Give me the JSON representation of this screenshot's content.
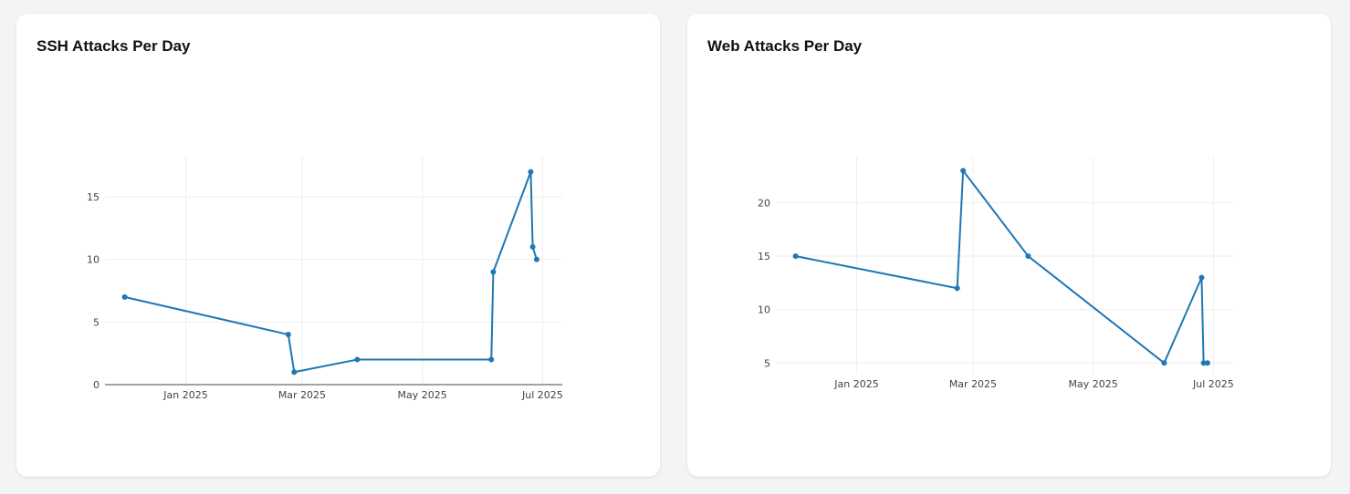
{
  "cards": [
    {
      "title": "SSH Attacks Per Day"
    },
    {
      "title": "Web Attacks Per Day"
    }
  ],
  "colors": {
    "line": "#1f77b4",
    "grid": "#eeeeee",
    "axis": "#444444",
    "card_background": "#ffffff",
    "page_background": "#f3f4f6"
  },
  "chart_data": [
    {
      "type": "line",
      "title": "SSH Attacks Per Day",
      "xlabel": "",
      "ylabel": "",
      "grid": true,
      "xlim": [
        "2024-11-21",
        "2025-07-11"
      ],
      "ylim": [
        0,
        18.2
      ],
      "x_ticks": [
        {
          "date": "2025-01-01",
          "label": "Jan 2025"
        },
        {
          "date": "2025-03-01",
          "label": "Mar 2025"
        },
        {
          "date": "2025-05-01",
          "label": "May 2025"
        },
        {
          "date": "2025-07-01",
          "label": "Jul 2025"
        }
      ],
      "y_ticks": [
        0,
        5,
        10,
        15
      ],
      "series": [
        {
          "x": [
            "2024-12-01",
            "2025-02-22",
            "2025-02-25",
            "2025-03-29",
            "2025-06-05",
            "2025-06-06",
            "2025-06-25",
            "2025-06-26",
            "2025-06-28"
          ],
          "y": [
            7,
            4,
            1,
            2,
            2,
            9,
            17,
            11,
            10
          ]
        }
      ]
    },
    {
      "type": "line",
      "title": "Web Attacks Per Day",
      "xlabel": "",
      "ylabel": "",
      "grid": true,
      "xlim": [
        "2024-11-21",
        "2025-07-11"
      ],
      "ylim": [
        4.0,
        24.3
      ],
      "x_ticks": [
        {
          "date": "2025-01-01",
          "label": "Jan 2025"
        },
        {
          "date": "2025-03-01",
          "label": "Mar 2025"
        },
        {
          "date": "2025-05-01",
          "label": "May 2025"
        },
        {
          "date": "2025-07-01",
          "label": "Jul 2025"
        }
      ],
      "y_ticks": [
        5,
        10,
        15,
        20
      ],
      "series": [
        {
          "x": [
            "2024-12-01",
            "2025-02-21",
            "2025-02-24",
            "2025-03-29",
            "2025-06-06",
            "2025-06-25",
            "2025-06-26",
            "2025-06-28"
          ],
          "y": [
            15,
            12,
            23,
            15,
            5,
            13,
            5,
            5
          ]
        }
      ]
    }
  ]
}
